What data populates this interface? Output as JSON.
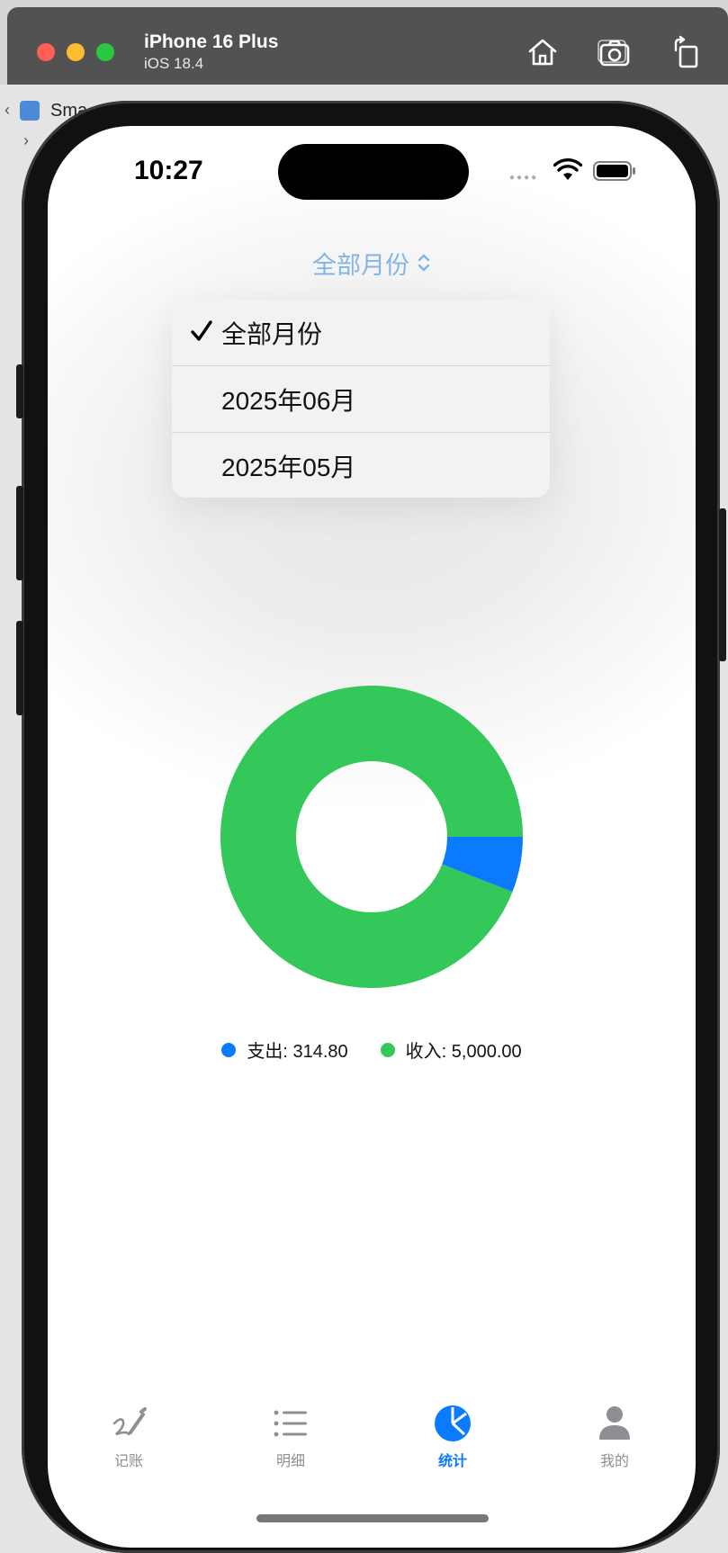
{
  "simulator": {
    "device_name": "iPhone 16 Plus",
    "os_version": "iOS 18.4",
    "background_fragment": "Sma"
  },
  "status_bar": {
    "time": "10:27"
  },
  "month_picker": {
    "current": "全部月份",
    "options": [
      {
        "label": "全部月份",
        "selected": true
      },
      {
        "label": "2025年06月",
        "selected": false
      },
      {
        "label": "2025年05月",
        "selected": false
      }
    ]
  },
  "chart_data": {
    "type": "pie",
    "donut": true,
    "categories": [
      "支出",
      "收入"
    ],
    "values": [
      314.8,
      5000.0
    ],
    "colors": [
      "#0a7aff",
      "#34c759"
    ],
    "legend": [
      "支出: 314.80",
      "收入: 5,000.00"
    ],
    "legend_position": "bottom"
  },
  "tabs": [
    {
      "label": "记账",
      "icon": "pen-scribble-icon",
      "active": false
    },
    {
      "label": "明细",
      "icon": "list-icon",
      "active": false
    },
    {
      "label": "统计",
      "icon": "pie-chart-icon",
      "active": true
    },
    {
      "label": "我的",
      "icon": "person-icon",
      "active": false
    }
  ],
  "colors": {
    "accent": "#0a7aff",
    "income": "#34c759",
    "inactive_tab": "#8e8e93",
    "picker_text": "#82b4e6"
  }
}
